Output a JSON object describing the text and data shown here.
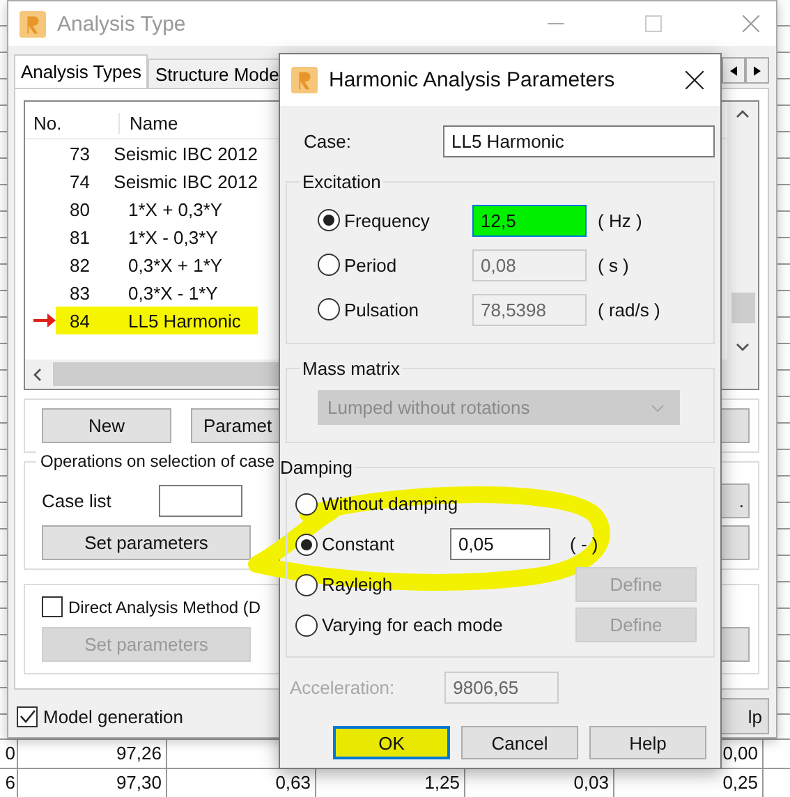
{
  "spreadsheet": {
    "rows": [
      {
        "cells": [
          "0",
          "97,26",
          null,
          null,
          null,
          "0,00"
        ]
      },
      {
        "cells": [
          "6",
          "97,30",
          "0,63",
          "1,25",
          "0,03",
          "0,25"
        ]
      }
    ]
  },
  "main_window": {
    "title": "Analysis Type",
    "tabs": [
      {
        "label": "Analysis Types",
        "selected": true
      },
      {
        "label": "Structure Mode",
        "selected": false
      }
    ],
    "cases": {
      "columns": [
        "No.",
        "Name"
      ],
      "rows": [
        {
          "no": "73",
          "name": "Seismic IBC 2012",
          "selected": false
        },
        {
          "no": "74",
          "name": "Seismic IBC 2012",
          "selected": false
        },
        {
          "no": "80",
          "name": "1*X + 0,3*Y",
          "selected": false
        },
        {
          "no": "81",
          "name": "1*X - 0,3*Y",
          "selected": false
        },
        {
          "no": "82",
          "name": "0,3*X + 1*Y",
          "selected": false
        },
        {
          "no": "83",
          "name": "0,3*X - 1*Y",
          "selected": false
        },
        {
          "no": "84",
          "name": "LL5 Harmonic",
          "selected": true
        }
      ]
    },
    "buttons": [
      {
        "label": "New"
      },
      {
        "label": "Paramet"
      }
    ],
    "operations": {
      "title": "Operations on selection of case",
      "case_list_label": "Case list",
      "set_parameters": {
        "label": "Set parameters",
        "disabled": false
      }
    },
    "dam": {
      "label": "Direct Analysis Method (D",
      "checked": false,
      "set_parameters": {
        "label": "Set parameters",
        "disabled": true
      }
    },
    "model_generation": {
      "label": "Model generation",
      "checked": true
    },
    "edge_button_text": ".",
    "help_button": "lp"
  },
  "dialog": {
    "title": "Harmonic Analysis Parameters",
    "case_label": "Case:",
    "case_value": "LL5 Harmonic",
    "excitation": {
      "title": "Excitation",
      "options": [
        {
          "label": "Frequency",
          "selected": true,
          "value": "12,5",
          "unit": "( Hz )",
          "highlighted": true
        },
        {
          "label": "Period",
          "selected": false,
          "value": "0,08",
          "unit": "( s )",
          "highlighted": false
        },
        {
          "label": "Pulsation",
          "selected": false,
          "value": "78,5398",
          "unit": "( rad/s )",
          "highlighted": false
        }
      ]
    },
    "mass_matrix": {
      "title": "Mass matrix",
      "value": "Lumped without rotations",
      "disabled": true
    },
    "damping": {
      "title": "Damping",
      "options": [
        {
          "kind": "plain",
          "label": "Without damping",
          "selected": false
        },
        {
          "kind": "value",
          "label": "Constant",
          "selected": true,
          "value": "0,05",
          "unit": "( - )"
        },
        {
          "kind": "define",
          "label": "Rayleigh",
          "selected": false,
          "button": "Define"
        },
        {
          "kind": "define",
          "label": "Varying for each mode",
          "selected": false,
          "button": "Define"
        }
      ]
    },
    "acceleration": {
      "label": "Acceleration:",
      "value": "9806,65",
      "disabled": true
    },
    "buttons": [
      {
        "label": "OK",
        "highlighted": true
      },
      {
        "label": "Cancel",
        "highlighted": false
      },
      {
        "label": "Help",
        "highlighted": false
      }
    ]
  }
}
